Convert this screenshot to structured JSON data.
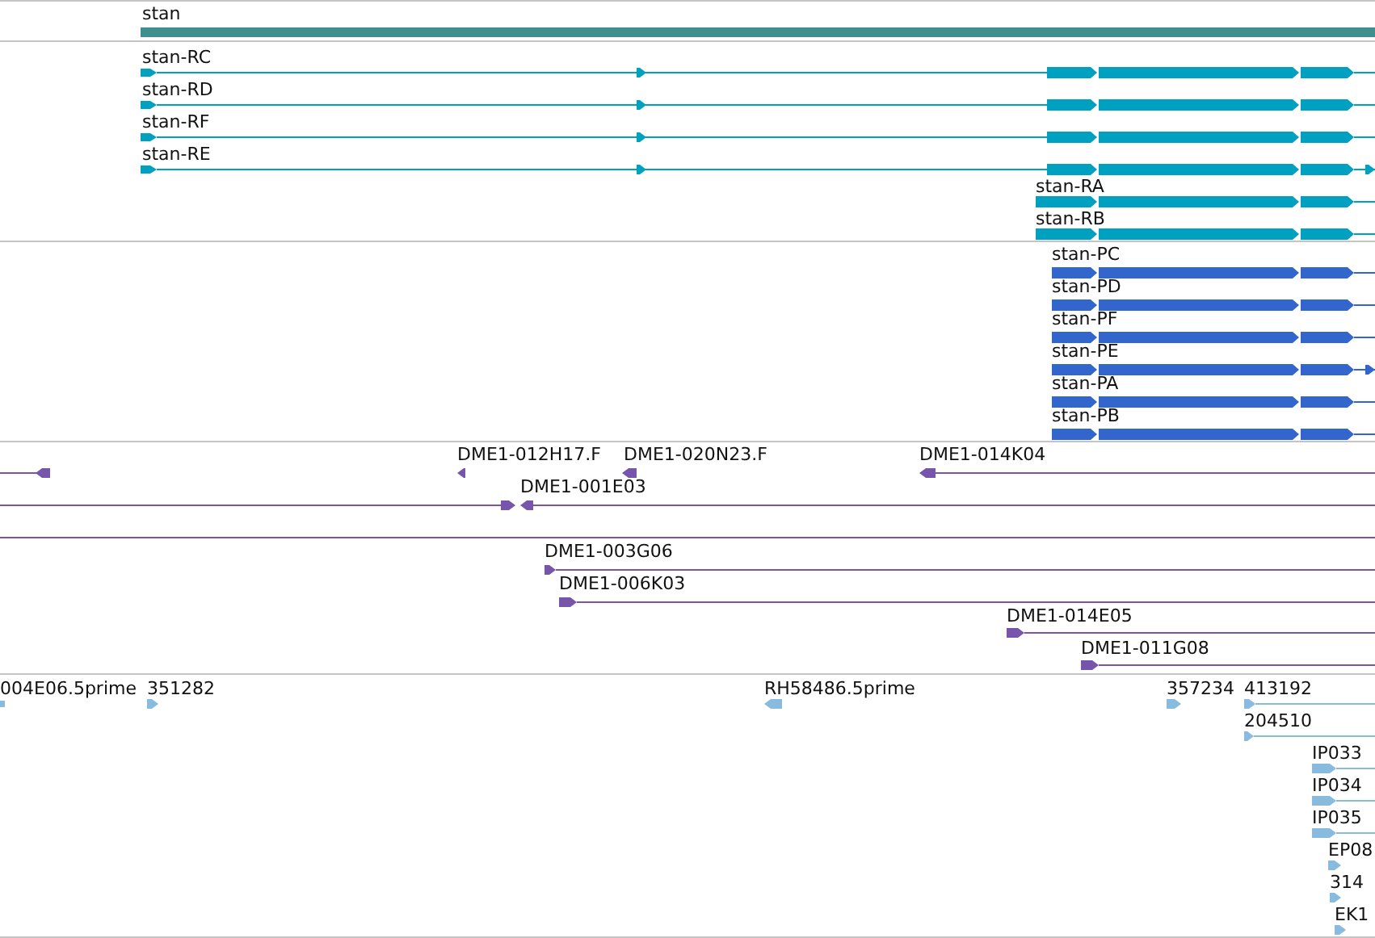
{
  "tracks": [
    {
      "color": "#3f8f8f",
      "features": [
        {
          "label": "stan"
        }
      ]
    },
    {
      "color": "#00a0c0",
      "features": [
        {
          "label": "stan-RC"
        },
        {
          "label": "stan-RD"
        },
        {
          "label": "stan-RF"
        },
        {
          "label": "stan-RE"
        },
        {
          "label": "stan-RA"
        },
        {
          "label": "stan-RB"
        }
      ]
    },
    {
      "color": "#3366cc",
      "features": [
        {
          "label": "stan-PC"
        },
        {
          "label": "stan-PD"
        },
        {
          "label": "stan-PF"
        },
        {
          "label": "stan-PE"
        },
        {
          "label": "stan-PA"
        },
        {
          "label": "stan-PB"
        }
      ]
    },
    {
      "color": "#7755aa",
      "features": [
        {
          "label": "DME1-012H17.F"
        },
        {
          "label": "DME1-020N23.F"
        },
        {
          "label": "DME1-014K04"
        },
        {
          "label": "DME1-001E03"
        },
        {
          "label": "DME1-003G06"
        },
        {
          "label": "DME1-006K03"
        },
        {
          "label": "DME1-014E05"
        },
        {
          "label": "DME1-011G08"
        }
      ]
    },
    {
      "color": "#88bbdd",
      "features": [
        {
          "label": "004E06.5prime"
        },
        {
          "label": "351282"
        },
        {
          "label": "RH58486.5prime"
        },
        {
          "label": "357234"
        },
        {
          "label": "413192"
        },
        {
          "label": "204510"
        },
        {
          "label": "IP033"
        },
        {
          "label": "IP034"
        },
        {
          "label": "IP035"
        },
        {
          "label": "EP08"
        },
        {
          "label": "314"
        },
        {
          "label": "EK1"
        }
      ]
    }
  ]
}
